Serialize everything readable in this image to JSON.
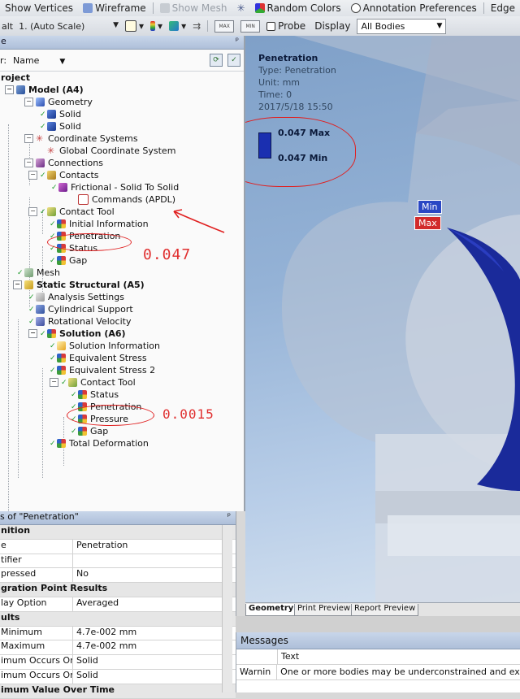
{
  "toolbar1": {
    "show_vertices": "Show Vertices",
    "wireframe": "Wireframe",
    "show_mesh": "Show Mesh",
    "random_colors": "Random Colors",
    "annotation_prefs": "Annotation Preferences",
    "edge": "Edge"
  },
  "toolbar2": {
    "scale_prefix": "alt",
    "scale_value": "1. (Auto Scale)",
    "probe": "Probe",
    "display_label": "Display",
    "display_value": "All Bodies"
  },
  "outline": {
    "header": "e",
    "filter_label": "r:",
    "filter_value": "Name",
    "nodes": [
      {
        "label": "roject",
        "bold": true
      },
      {
        "label": "Model (A4)",
        "bold": true
      },
      {
        "label": "Geometry"
      },
      {
        "label": "Solid"
      },
      {
        "label": "Solid"
      },
      {
        "label": "Coordinate Systems"
      },
      {
        "label": "Global Coordinate System"
      },
      {
        "label": "Connections"
      },
      {
        "label": "Contacts"
      },
      {
        "label": "Frictional - Solid To Solid"
      },
      {
        "label": "Commands (APDL)"
      },
      {
        "label": "Contact Tool"
      },
      {
        "label": "Initial Information"
      },
      {
        "label": "Penetration"
      },
      {
        "label": "Status"
      },
      {
        "label": "Gap"
      },
      {
        "label": "Mesh"
      },
      {
        "label": "Static Structural (A5)",
        "bold": true
      },
      {
        "label": "Analysis Settings"
      },
      {
        "label": "Cylindrical Support"
      },
      {
        "label": "Rotational Velocity"
      },
      {
        "label": "Solution (A6)",
        "bold": true
      },
      {
        "label": "Solution Information"
      },
      {
        "label": "Equivalent Stress"
      },
      {
        "label": "Equivalent Stress 2"
      },
      {
        "label": "Contact Tool"
      },
      {
        "label": "Status"
      },
      {
        "label": "Penetration"
      },
      {
        "label": "Pressure"
      },
      {
        "label": "Gap"
      },
      {
        "label": "Total Deformation"
      }
    ]
  },
  "annotations": {
    "first": "0.047",
    "second": "0.0015"
  },
  "details": {
    "header": "s of \"Penetration\"",
    "rows": [
      {
        "key": "nition",
        "value": "",
        "group": true
      },
      {
        "key": "e",
        "value": "Penetration"
      },
      {
        "key": "tifier",
        "value": ""
      },
      {
        "key": "pressed",
        "value": "No"
      },
      {
        "key": "gration Point Results",
        "value": "",
        "group": true
      },
      {
        "key": "lay Option",
        "value": "Averaged"
      },
      {
        "key": "ults",
        "value": "",
        "group": true
      },
      {
        "key": "Minimum",
        "value": "4.7e-002 mm"
      },
      {
        "key": "Maximum",
        "value": "4.7e-002 mm"
      },
      {
        "key": "imum Occurs On",
        "value": "Solid"
      },
      {
        "key": "imum Occurs On",
        "value": "Solid"
      },
      {
        "key": "imum Value Over Time",
        "value": "",
        "group": true
      }
    ]
  },
  "viewport": {
    "legend_title": "Penetration",
    "legend_type": "Type: Penetration",
    "legend_unit": "Unit: mm",
    "legend_time": "Time: 0",
    "legend_date": "2017/5/18 15:50",
    "legend_max": "0.047 Max",
    "legend_min": "0.047 Min",
    "probe_min": "Min",
    "probe_max": "Max",
    "tabs": [
      "Geometry",
      "Print Preview",
      "Report Preview"
    ]
  },
  "messages": {
    "header": "Messages",
    "col_text": "Text",
    "rows": [
      {
        "type": "Warnin",
        "text": "One or more bodies may be underconstrained and exp"
      }
    ]
  },
  "colors": {
    "legend_band": "#1a2fb0",
    "probe_min": "#2a47c4",
    "probe_max": "#d22a2a",
    "annotation": "#e02020"
  }
}
